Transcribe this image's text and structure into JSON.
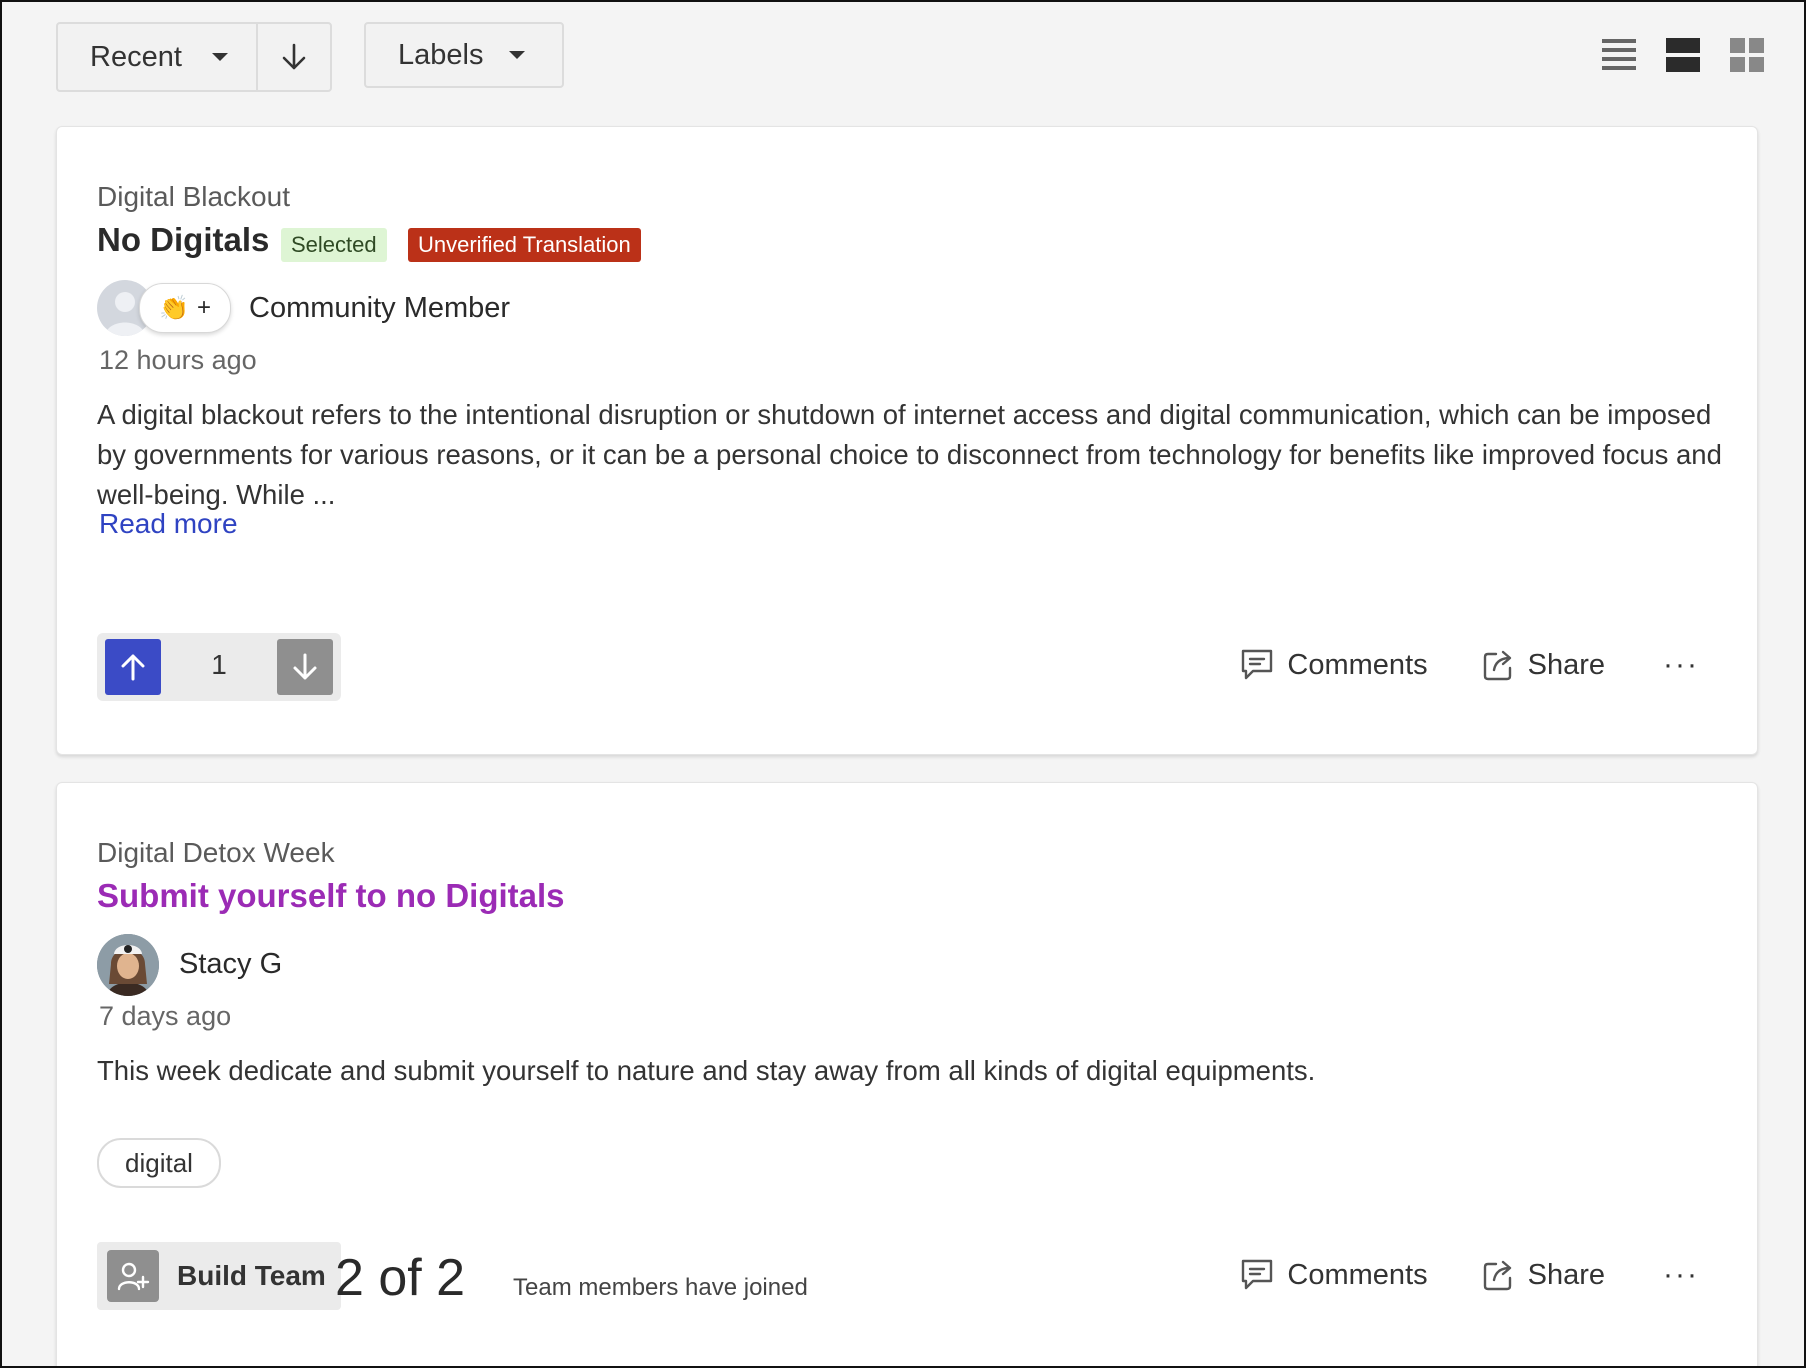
{
  "toolbar": {
    "sort_label": "Recent",
    "labels_label": "Labels",
    "view_modes": [
      "list-view-icon",
      "card-view-icon",
      "grid-view-icon"
    ]
  },
  "colors": {
    "upvote": "#3b4bc6",
    "unverified_badge": "#bb3118",
    "selected_badge": "#def5d4",
    "link": "#2f43c2",
    "title_purple": "#9b2bb5"
  },
  "posts": [
    {
      "campaign": "Digital Blackout",
      "title": "No Digitals",
      "badges": [
        "Selected",
        "Unverified Translation"
      ],
      "reaction": "👏",
      "reaction_add": "+",
      "author": "Community Member",
      "time": "12 hours ago",
      "description": "A digital blackout refers to the intentional disruption or shutdown of internet access and digital communication, which can be imposed by governments for various reasons, or it can be a personal choice to disconnect from technology for benefits like improved focus and well-being. While ...",
      "read_more": "Read more",
      "votes": "1",
      "comments_label": "Comments",
      "share_label": "Share",
      "more_label": "···"
    },
    {
      "campaign": "Digital Detox Week",
      "title": "Submit yourself to no Digitals",
      "author": "Stacy G",
      "time": "7 days ago",
      "description": "This week dedicate and submit yourself to nature and stay away from all kinds of digital equipments.",
      "tag": "digital",
      "build_team_label": "Build Team",
      "team_count": "2 of 2",
      "team_text": "Team members have joined",
      "comments_label": "Comments",
      "share_label": "Share",
      "more_label": "···"
    }
  ]
}
